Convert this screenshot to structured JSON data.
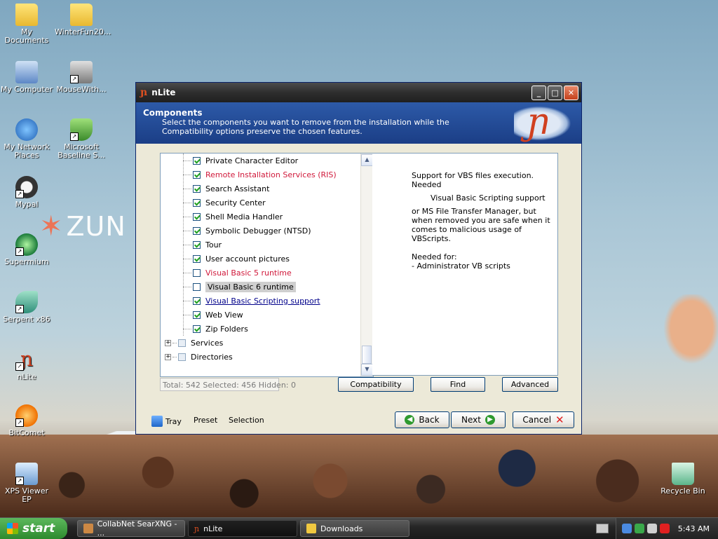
{
  "desktop": {
    "icons": [
      {
        "label": "My Documents"
      },
      {
        "label": "WinterFun20..."
      },
      {
        "label": "My Computer"
      },
      {
        "label": "MouseWith..."
      },
      {
        "label": "My Network Places"
      },
      {
        "label": "Microsoft Baseline S..."
      },
      {
        "label": "Mypal"
      },
      {
        "label": "Supermium"
      },
      {
        "label": "Serpent x86"
      },
      {
        "label": "nLite"
      },
      {
        "label": "BitComet"
      },
      {
        "label": "XPS Viewer EP"
      },
      {
        "label": "Recycle Bin"
      }
    ],
    "wallpaper_logo": "ZUN"
  },
  "window": {
    "title": "nLite",
    "controls": {
      "minimize": "_",
      "maximize": "□",
      "close": "✕"
    },
    "header": {
      "title": "Components",
      "description": "Select the components you want to remove from the installation while the Compatibility options preserve the chosen features."
    },
    "tree": {
      "items": [
        {
          "label": "Private Character Editor",
          "checked": true
        },
        {
          "label": "Remote Installation Services (RIS)",
          "checked": true,
          "style": "red"
        },
        {
          "label": "Search Assistant",
          "checked": true
        },
        {
          "label": "Security Center",
          "checked": true
        },
        {
          "label": "Shell Media Handler",
          "checked": true
        },
        {
          "label": "Symbolic Debugger (NTSD)",
          "checked": true
        },
        {
          "label": "Tour",
          "checked": true
        },
        {
          "label": "User account pictures",
          "checked": true
        },
        {
          "label": "Visual Basic 5 runtime",
          "checked": false,
          "style": "red"
        },
        {
          "label": "Visual Basic 6 runtime",
          "checked": false,
          "style": "selected"
        },
        {
          "label": "Visual Basic Scripting support",
          "checked": true,
          "style": "link"
        },
        {
          "label": "Web View",
          "checked": true
        },
        {
          "label": "Zip Folders",
          "checked": true
        }
      ],
      "groups": [
        {
          "label": "Services"
        },
        {
          "label": "Directories"
        }
      ],
      "scroll_up": "▲",
      "scroll_down": "▼"
    },
    "description_panel": {
      "line1": "Support for VBS files execution. Needed",
      "title": "Visual Basic Scripting support",
      "line2": "or MS File Transfer Manager, but when removed you are safe when it comes to malicious usage of VBScripts.",
      "needed_for_label": "Needed for:",
      "needed_for_item": " - Administrator VB scripts"
    },
    "status": "Total: 542 Selected: 456 Hidden: 0",
    "buttons": {
      "compatibility": "Compatibility",
      "find": "Find",
      "advanced": "Advanced"
    },
    "footer": {
      "tray": "Tray",
      "preset": "Preset",
      "selection": "Selection",
      "back": "Back",
      "next": "Next",
      "cancel": "Cancel"
    }
  },
  "taskbar": {
    "start": "start",
    "tasks": [
      {
        "label": "CollabNet SearXNG - ..."
      },
      {
        "label": "nLite",
        "active": true
      },
      {
        "label": "Downloads"
      }
    ],
    "clock": "5:43 AM"
  }
}
